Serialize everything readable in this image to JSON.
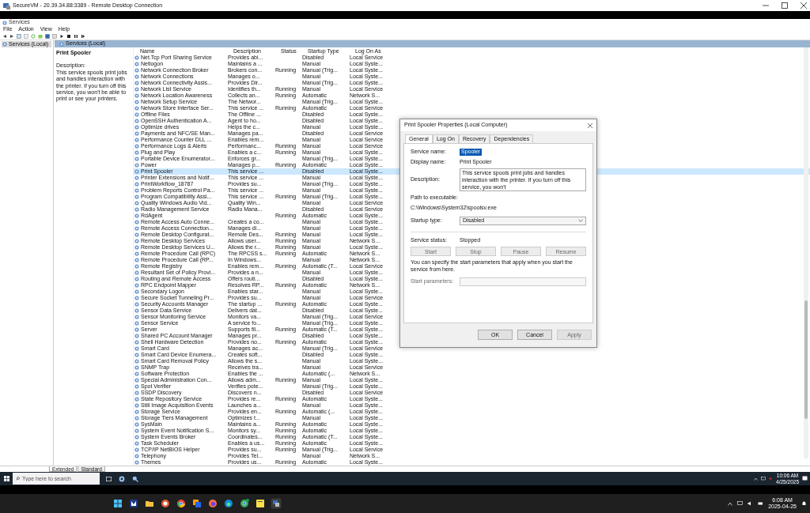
{
  "rdp_window": {
    "title": "SecureVM - 20.39.34.88:3389 - Remote Desktop Connection"
  },
  "services_window": {
    "title": "Services",
    "menu": [
      "File",
      "Action",
      "View",
      "Help"
    ],
    "tree": [
      {
        "label": "Services (Local)",
        "selected": true
      }
    ],
    "panel_title": "Services (Local)",
    "description_pane": {
      "service": "Print Spooler",
      "heading": "Description:",
      "text": "This service spools print jobs and handles interaction with the printer. If you turn off this service, you won't be able to print or see your printers."
    },
    "columns": [
      "Name",
      "Description",
      "Status",
      "Startup Type",
      "Log On As"
    ],
    "rows": [
      {
        "name": "Net.Tcp Port Sharing Service",
        "description": "Provides abi...",
        "startup_type": "Disabled",
        "log_on_as": "Local Service",
        "selected": false
      },
      {
        "name": "Netlogon",
        "description": "Maintains a ...",
        "startup_type": "Manual",
        "log_on_as": "Local Syste...",
        "selected": false
      },
      {
        "name": "Network Connection Broker",
        "description": "Brokers con...",
        "status": "Running",
        "startup_type": "Manual (Trig...",
        "log_on_as": "Local Syste...",
        "selected": false
      },
      {
        "name": "Network Connections",
        "description": "Manages o...",
        "startup_type": "Manual",
        "log_on_as": "Local Syste...",
        "selected": false
      },
      {
        "name": "Network Connectivity Assis...",
        "description": "Provides Dir...",
        "startup_type": "Manual (Trig...",
        "log_on_as": "Local Syste...",
        "selected": false
      },
      {
        "name": "Network List Service",
        "description": "Identifies th...",
        "status": "Running",
        "startup_type": "Manual",
        "log_on_as": "Local Service",
        "selected": false
      },
      {
        "name": "Network Location Awareness",
        "description": "Collects an...",
        "status": "Running",
        "startup_type": "Automatic",
        "log_on_as": "Network S...",
        "selected": false
      },
      {
        "name": "Network Setup Service",
        "description": "The Networ...",
        "startup_type": "Manual (Trig...",
        "log_on_as": "Local Syste...",
        "selected": false
      },
      {
        "name": "Network Store Interface Ser...",
        "description": "This service ...",
        "status": "Running",
        "startup_type": "Automatic",
        "log_on_as": "Local Service",
        "selected": false
      },
      {
        "name": "Offline Files",
        "description": "The Offline ...",
        "startup_type": "Disabled",
        "log_on_as": "Local Syste...",
        "selected": false
      },
      {
        "name": "OpenSSH Authentication A...",
        "description": "Agent to ho...",
        "startup_type": "Disabled",
        "log_on_as": "Local Syste...",
        "selected": false
      },
      {
        "name": "Optimize drives",
        "description": "Helps the c...",
        "startup_type": "Manual",
        "log_on_as": "Local Syste...",
        "selected": false
      },
      {
        "name": "Payments and NFC/SE Man...",
        "description": "Manages pa...",
        "startup_type": "Disabled",
        "log_on_as": "Local Service",
        "selected": false
      },
      {
        "name": "Performance Counter DLL ...",
        "description": "Enables rem...",
        "startup_type": "Manual",
        "log_on_as": "Local Service",
        "selected": false
      },
      {
        "name": "Performance Logs & Alerts",
        "description": "Performanc...",
        "status": "Running",
        "startup_type": "Manual",
        "log_on_as": "Local Service",
        "selected": false
      },
      {
        "name": "Plug and Play",
        "description": "Enables a c...",
        "status": "Running",
        "startup_type": "Manual",
        "log_on_as": "Local Syste...",
        "selected": false
      },
      {
        "name": "Portable Device Enumerator...",
        "description": "Enforces gr...",
        "startup_type": "Manual (Trig...",
        "log_on_as": "Local Syste...",
        "selected": false
      },
      {
        "name": "Power",
        "description": "Manages p...",
        "status": "Running",
        "startup_type": "Automatic",
        "log_on_as": "Local Syste...",
        "selected": false
      },
      {
        "name": "Print Spooler",
        "description": "This service ...",
        "startup_type": "Disabled",
        "log_on_as": "Local Syste...",
        "selected": true
      },
      {
        "name": "Printer Extensions and Notif...",
        "description": "This service ...",
        "startup_type": "Manual",
        "log_on_as": "Local Syste...",
        "selected": false
      },
      {
        "name": "PrintWorkflow_18787",
        "description": "Provides su...",
        "startup_type": "Manual (Trig...",
        "log_on_as": "Local Syste...",
        "selected": false
      },
      {
        "name": "Problem Reports Control Pa...",
        "description": "This service ...",
        "startup_type": "Manual",
        "log_on_as": "Local Syste...",
        "selected": false
      },
      {
        "name": "Program Compatibility Assi...",
        "description": "This service ...",
        "status": "Running",
        "startup_type": "Manual (Trig...",
        "log_on_as": "Local Syste...",
        "selected": false
      },
      {
        "name": "Quality Windows Audio Vid...",
        "description": "Quality Win...",
        "startup_type": "Manual",
        "log_on_as": "Local Service",
        "selected": false
      },
      {
        "name": "Radio Management Service",
        "description": "Radio Mana...",
        "startup_type": "Disabled",
        "log_on_as": "Local Service",
        "selected": false
      },
      {
        "name": "RdAgent",
        "status": "Running",
        "startup_type": "Automatic",
        "log_on_as": "Local Syste...",
        "selected": false
      },
      {
        "name": "Remote Access Auto Conne...",
        "description": "Creates a co...",
        "startup_type": "Manual",
        "log_on_as": "Local Syste...",
        "selected": false
      },
      {
        "name": "Remote Access Connection...",
        "description": "Manages di...",
        "startup_type": "Manual",
        "log_on_as": "Local Syste...",
        "selected": false
      },
      {
        "name": "Remote Desktop Configurat...",
        "description": "Remote Des...",
        "status": "Running",
        "startup_type": "Manual",
        "log_on_as": "Local Syste...",
        "selected": false
      },
      {
        "name": "Remote Desktop Services",
        "description": "Allows user...",
        "status": "Running",
        "startup_type": "Manual",
        "log_on_as": "Network S...",
        "selected": false
      },
      {
        "name": "Remote Desktop Services U...",
        "description": "Allows the r...",
        "status": "Running",
        "startup_type": "Manual",
        "log_on_as": "Local Syste...",
        "selected": false
      },
      {
        "name": "Remote Procedure Call (RPC)",
        "description": "The RPCSS s...",
        "status": "Running",
        "startup_type": "Automatic",
        "log_on_as": "Network S...",
        "selected": false
      },
      {
        "name": "Remote Procedure Call (RP...",
        "description": "In Windows...",
        "startup_type": "Manual",
        "log_on_as": "Network S...",
        "selected": false
      },
      {
        "name": "Remote Registry",
        "description": "Enables rem...",
        "status": "Running",
        "startup_type": "Automatic (T...",
        "log_on_as": "Local Service",
        "selected": false
      },
      {
        "name": "Resultant Set of Policy Provi...",
        "description": "Provides a n...",
        "startup_type": "Manual",
        "log_on_as": "Local Syste...",
        "selected": false
      },
      {
        "name": "Routing and Remote Access",
        "description": "Offers routi...",
        "startup_type": "Disabled",
        "log_on_as": "Local Syste...",
        "selected": false
      },
      {
        "name": "RPC Endpoint Mapper",
        "description": "Resolves RP...",
        "status": "Running",
        "startup_type": "Automatic",
        "log_on_as": "Network S...",
        "selected": false
      },
      {
        "name": "Secondary Logon",
        "description": "Enables star...",
        "startup_type": "Manual",
        "log_on_as": "Local Syste...",
        "selected": false
      },
      {
        "name": "Secure Socket Tunneling Pr...",
        "description": "Provides su...",
        "startup_type": "Manual",
        "log_on_as": "Local Service",
        "selected": false
      },
      {
        "name": "Security Accounts Manager",
        "description": "The startup ...",
        "status": "Running",
        "startup_type": "Automatic",
        "log_on_as": "Local Syste...",
        "selected": false
      },
      {
        "name": "Sensor Data Service",
        "description": "Delivers dat...",
        "startup_type": "Disabled",
        "log_on_as": "Local Syste...",
        "selected": false
      },
      {
        "name": "Sensor Monitoring Service",
        "description": "Monitors va...",
        "startup_type": "Manual (Trig...",
        "log_on_as": "Local Service",
        "selected": false
      },
      {
        "name": "Sensor Service",
        "description": "A service fo...",
        "startup_type": "Manual (Trig...",
        "log_on_as": "Local Syste...",
        "selected": false
      },
      {
        "name": "Server",
        "description": "Supports fil...",
        "status": "Running",
        "startup_type": "Automatic (T...",
        "log_on_as": "Local Syste...",
        "selected": false
      },
      {
        "name": "Shared PC Account Manager",
        "description": "Manages pr...",
        "startup_type": "Disabled",
        "log_on_as": "Local Syste...",
        "selected": false
      },
      {
        "name": "Shell Hardware Detection",
        "description": "Provides no...",
        "status": "Running",
        "startup_type": "Automatic",
        "log_on_as": "Local Syste...",
        "selected": false
      },
      {
        "name": "Smart Card",
        "description": "Manages ac...",
        "startup_type": "Manual (Trig...",
        "log_on_as": "Local Service",
        "selected": false
      },
      {
        "name": "Smart Card Device Enumera...",
        "description": "Creates soft...",
        "startup_type": "Disabled",
        "log_on_as": "Local Syste...",
        "selected": false
      },
      {
        "name": "Smart Card Removal Policy",
        "description": "Allows the s...",
        "startup_type": "Manual",
        "log_on_as": "Local Syste...",
        "selected": false
      },
      {
        "name": "SNMP Trap",
        "description": "Receives tra...",
        "startup_type": "Manual",
        "log_on_as": "Local Service",
        "selected": false
      },
      {
        "name": "Software Protection",
        "description": "Enables the ...",
        "startup_type": "Automatic (...",
        "log_on_as": "Network S...",
        "selected": false
      },
      {
        "name": "Special Administration Con...",
        "description": "Allows adm...",
        "status": "Running",
        "startup_type": "Manual",
        "log_on_as": "Local Syste...",
        "selected": false
      },
      {
        "name": "Spot Verifier",
        "description": "Verifies pote...",
        "startup_type": "Manual (Trig...",
        "log_on_as": "Local Syste...",
        "selected": false
      },
      {
        "name": "SSDP Discovery",
        "description": "Discovers n...",
        "startup_type": "Disabled",
        "log_on_as": "Local Service",
        "selected": false
      },
      {
        "name": "State Repository Service",
        "description": "Provides re...",
        "status": "Running",
        "startup_type": "Automatic",
        "log_on_as": "Local Syste...",
        "selected": false
      },
      {
        "name": "Still Image Acquisition Events",
        "description": "Launches a...",
        "startup_type": "Manual",
        "log_on_as": "Local Syste...",
        "selected": false
      },
      {
        "name": "Storage Service",
        "description": "Provides en...",
        "status": "Running",
        "startup_type": "Automatic (...",
        "log_on_as": "Local Syste...",
        "selected": false
      },
      {
        "name": "Storage Tiers Management",
        "description": "Optimizes t...",
        "startup_type": "Manual",
        "log_on_as": "Local Syste...",
        "selected": false
      },
      {
        "name": "SysMain",
        "description": "Maintains a...",
        "status": "Running",
        "startup_type": "Automatic",
        "log_on_as": "Local Syste...",
        "selected": false
      },
      {
        "name": "System Event Notification S...",
        "description": "Monitors sy...",
        "status": "Running",
        "startup_type": "Automatic",
        "log_on_as": "Local Syste...",
        "selected": false
      },
      {
        "name": "System Events Broker",
        "description": "Coordinates...",
        "status": "Running",
        "startup_type": "Automatic (T...",
        "log_on_as": "Local Syste...",
        "selected": false
      },
      {
        "name": "Task Scheduler",
        "description": "Enables a us...",
        "status": "Running",
        "startup_type": "Automatic",
        "log_on_as": "Local Syste...",
        "selected": false
      },
      {
        "name": "TCP/IP NetBIOS Helper",
        "description": "Provides su...",
        "status": "Running",
        "startup_type": "Manual (Trig...",
        "log_on_as": "Local Service",
        "selected": false
      },
      {
        "name": "Telephony",
        "description": "Provides Tel...",
        "startup_type": "Manual",
        "log_on_as": "Network S...",
        "selected": false
      },
      {
        "name": "Themes",
        "description": "Provides us...",
        "status": "Running",
        "startup_type": "Automatic",
        "log_on_as": "Local Syste...",
        "selected": false
      }
    ],
    "view_tabs": [
      {
        "label": "Extended",
        "selected": true
      },
      {
        "label": "Standard",
        "selected": false
      }
    ]
  },
  "dialog": {
    "title": "Print Spooler Properties (Local Computer)",
    "tabs": [
      {
        "label": "General",
        "selected": true
      },
      {
        "label": "Log On",
        "selected": false
      },
      {
        "label": "Recovery",
        "selected": false
      },
      {
        "label": "Dependencies",
        "selected": false
      }
    ],
    "service_name": {
      "label": "Service name:",
      "value": "Spooler"
    },
    "display_name": {
      "label": "Display name:",
      "value": "Print Spooler"
    },
    "description": {
      "label": "Description:",
      "value": "This service spools print jobs and handles interaction with the printer.  If you turn off this service, you won't"
    },
    "path": {
      "label": "Path to executable:",
      "value": "C:\\Windows\\System32\\spoolsv.exe"
    },
    "startup_type": {
      "label": "Startup type:",
      "value": "Disabled"
    },
    "service_status": {
      "label": "Service status:",
      "value": "Stopped"
    },
    "control_buttons": [
      {
        "label": "Start",
        "disabled": true
      },
      {
        "label": "Stop",
        "disabled": true
      },
      {
        "label": "Pause",
        "disabled": true
      },
      {
        "label": "Resume",
        "disabled": true
      }
    ],
    "hint": "You can specify the start parameters that apply when you start the service from here.",
    "start_parameters": {
      "label": "Start parameters:",
      "disabled": true
    },
    "buttons": [
      {
        "label": "OK",
        "disabled": false
      },
      {
        "label": "Cancel",
        "disabled": false
      },
      {
        "label": "Apply",
        "disabled": true
      }
    ]
  },
  "remote_taskbar": {
    "search_placeholder": "Type here to search",
    "time": "10:06 AM",
    "date": "4/25/2025"
  },
  "host_taskbar": {
    "time": "6:08 AM",
    "date": "2025-04-25"
  }
}
